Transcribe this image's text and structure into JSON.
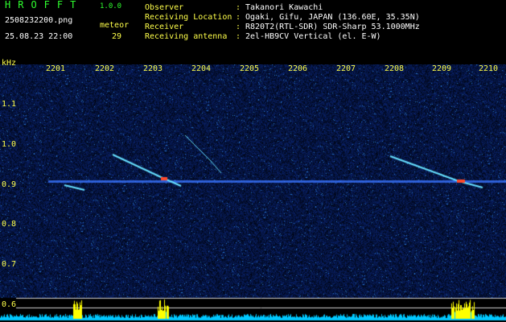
{
  "header": {
    "app_title": "HROFFT",
    "app_version": "1.0.0",
    "file_name": "2508232200.png",
    "datetime": "25.08.23 22:00",
    "meteor_label": "meteor",
    "meteor_count": "29",
    "info": [
      {
        "label": "Observer",
        "value": "Takanori Kawachi"
      },
      {
        "label": "Receiving Location",
        "value": "Ogaki, Gifu, JAPAN (136.60E, 35.35N)"
      },
      {
        "label": "Receiver",
        "value": "R820T2(RTL-SDR) SDR-Sharp 53.1000MHz"
      },
      {
        "label": "Receiving antenna",
        "value": "2el-HB9CV Vertical (el. E-W)"
      }
    ]
  },
  "axis": {
    "unit_label": "kHz",
    "time_ticks": [
      "2201",
      "2202",
      "2203",
      "2204",
      "2205",
      "2206",
      "2207",
      "2208",
      "2209",
      "2210"
    ],
    "freq_ticks": [
      "1.1",
      "1.0",
      "0.9",
      "0.8",
      "0.7",
      "0.6"
    ]
  },
  "colors": {
    "background": "#000000",
    "noise": "#0a1660",
    "carrier": "#3a74ff",
    "meteor_trail": "#66e0ff",
    "meteor_head": "#ff4a2a",
    "text_green": "#2fff2f",
    "text_yellow": "#ffff4a",
    "text_white": "#ffffff",
    "level_bar": "#ffff00",
    "baseline": "#00c8ff"
  }
}
